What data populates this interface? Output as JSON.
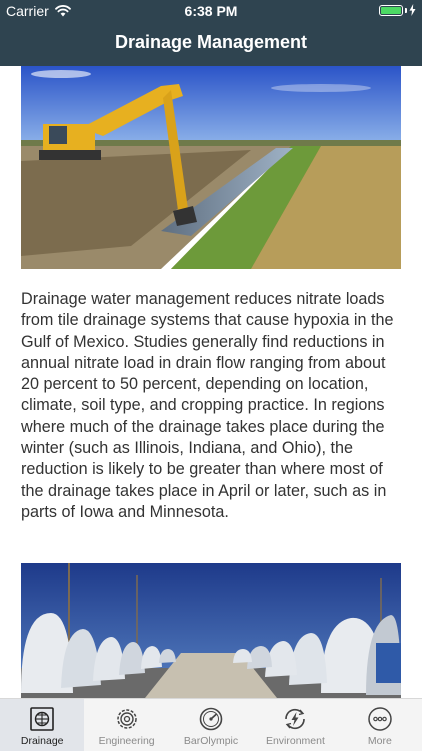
{
  "status_bar": {
    "carrier": "Carrier",
    "time": "6:38 PM",
    "battery_color": "#4cd964"
  },
  "nav": {
    "title": "Drainage Management"
  },
  "content": {
    "image1": {
      "subject": "excavator digging a drainage ditch beside a grassy field"
    },
    "paragraph": "Drainage water management reduces nitrate loads from tile drainage systems that cause hypoxia in the Gulf of Mexico. Studies generally find reductions in annual nitrate load in drain flow ranging from about 20 percent to 50 percent, depending on location, climate, soil type, and cropping practice. In regions where much of the drainage takes place during the winter (such as Illinois, Indiana, and Ohio), the reduction is likely to be greater than where most of the drainage takes place in April or later, such as in parts of Iowa and Minnesota.",
    "image2": {
      "subject": "rows of large white hoop structures along a gravel lane at dusk"
    }
  },
  "tabs": [
    {
      "label": "Drainage",
      "icon": "drainage-icon",
      "active": true
    },
    {
      "label": "Engineering",
      "icon": "engineering-icon",
      "active": false
    },
    {
      "label": "BarOlympic",
      "icon": "barolympic-icon",
      "active": false
    },
    {
      "label": "Environment",
      "icon": "environment-icon",
      "active": false
    },
    {
      "label": "More",
      "icon": "more-icon",
      "active": false
    }
  ],
  "colors": {
    "header_bg": "#2f4450",
    "tab_active_bg": "#e2e5ea",
    "tab_label": "#8a8a8a"
  }
}
